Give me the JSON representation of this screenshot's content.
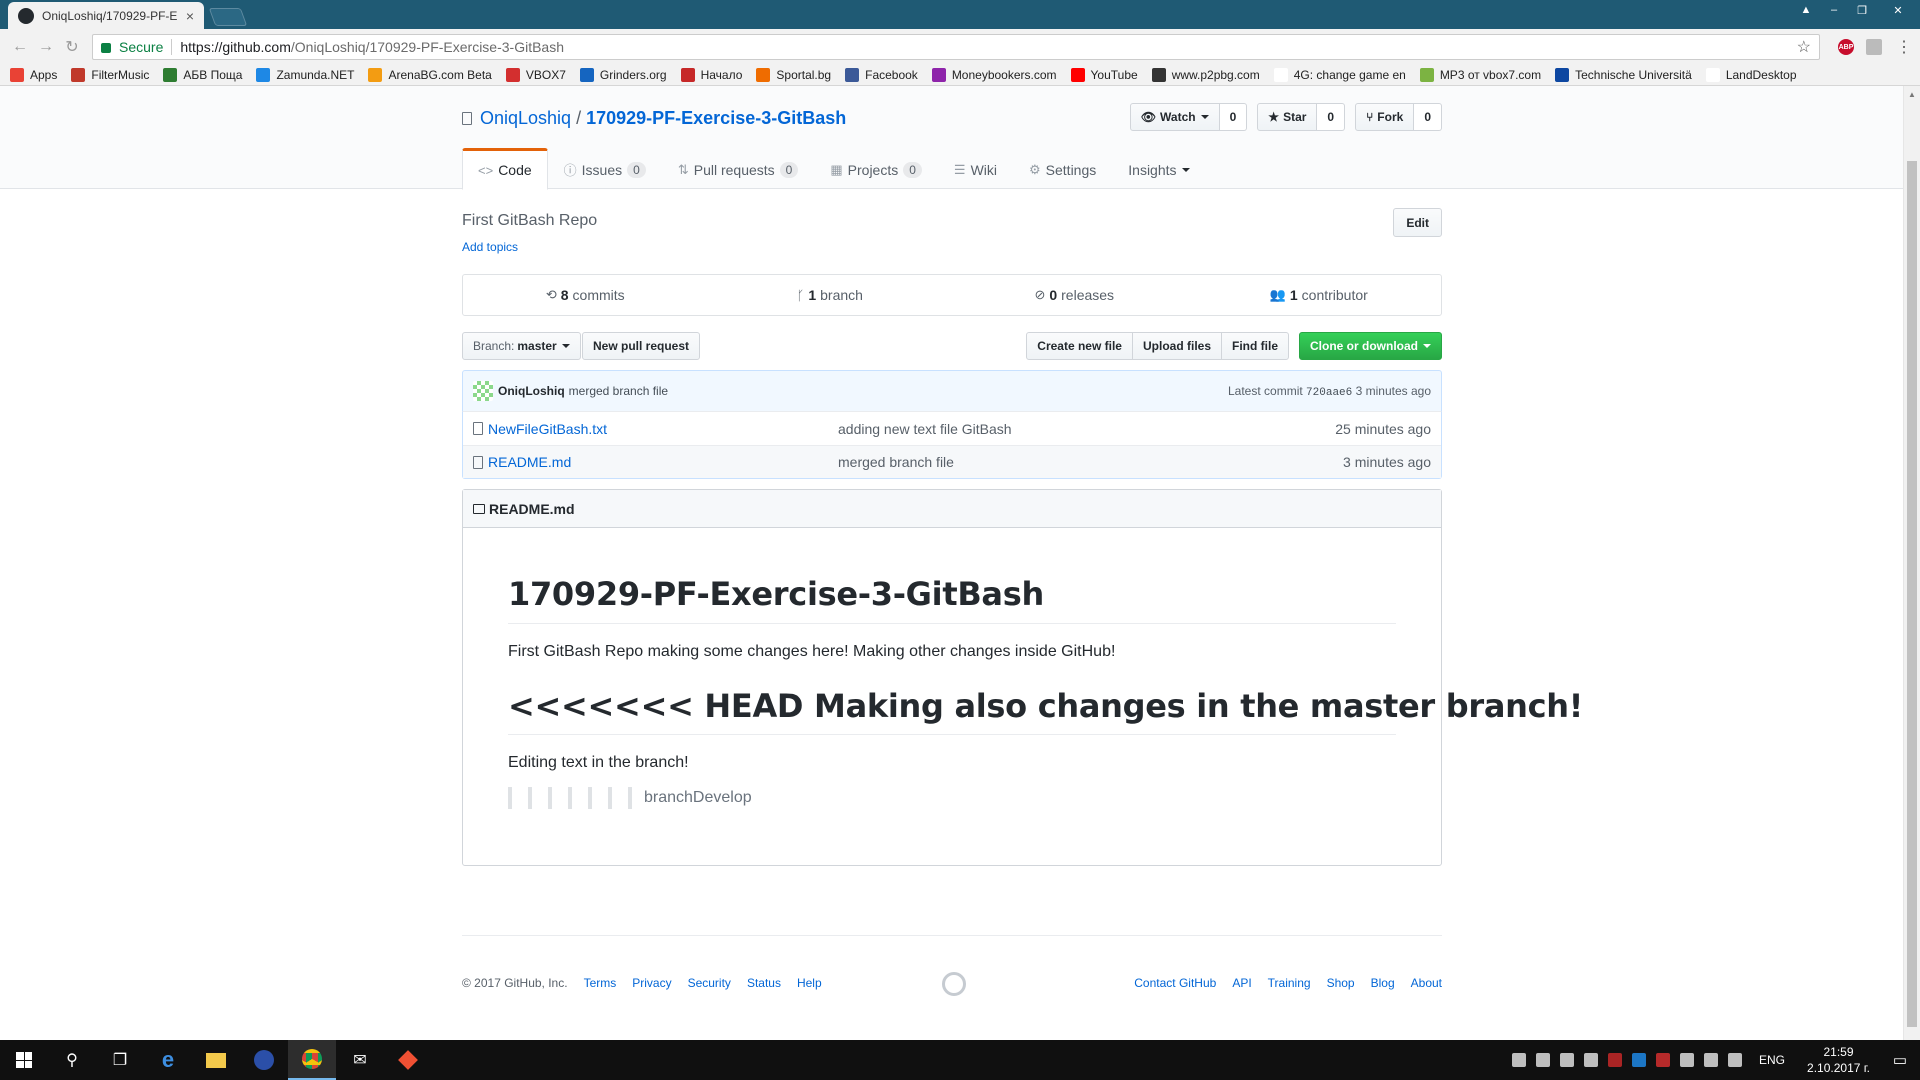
{
  "browser": {
    "tab_title": "OniqLoshiq/170929-PF-E",
    "tab_close": "×",
    "secure_label": "Secure",
    "url_host": "https://github.com",
    "url_path": "/OniqLoshiq/170929-PF-Exercise-3-GitBash",
    "abp_label": "ABP",
    "window_controls": [
      "▲",
      "–",
      "❐",
      "✕"
    ]
  },
  "bookmarks": [
    {
      "label": "Apps",
      "color": "#e94235"
    },
    {
      "label": "FilterMusic",
      "color": "#c0392b"
    },
    {
      "label": "АБВ Поща",
      "color": "#2e7d32"
    },
    {
      "label": "Zamunda.NET",
      "color": "#1e88e5"
    },
    {
      "label": "ArenaBG.com Beta",
      "color": "#f39c12"
    },
    {
      "label": "VBOX7",
      "color": "#d32f2f"
    },
    {
      "label": "Grinders.org",
      "color": "#1565c0"
    },
    {
      "label": "Начало",
      "color": "#c62828"
    },
    {
      "label": "Sportal.bg",
      "color": "#ef6c00"
    },
    {
      "label": "Facebook",
      "color": "#3b5998"
    },
    {
      "label": "Moneybookers.com",
      "color": "#8e24aa"
    },
    {
      "label": "YouTube",
      "color": "#ff0000"
    },
    {
      "label": "www.p2pbg.com",
      "color": "#333333"
    },
    {
      "label": "4G: change game en",
      "color": "#ffffff"
    },
    {
      "label": "MP3 от vbox7.com",
      "color": "#7cb342"
    },
    {
      "label": "Technische Universitä",
      "color": "#0d47a1"
    },
    {
      "label": "LandDesktop",
      "color": "#ffffff"
    }
  ],
  "repo": {
    "owner": "OniqLoshiq",
    "separator": "/",
    "name": "170929-PF-Exercise-3-GitBash",
    "actions": [
      {
        "icon": "👁",
        "label": "Watch",
        "count": "0",
        "dropdown": true
      },
      {
        "icon": "★",
        "label": "Star",
        "count": "0",
        "dropdown": false
      },
      {
        "icon": "⑂",
        "label": "Fork",
        "count": "0",
        "dropdown": false
      }
    ],
    "tabs": [
      {
        "icon": "<>",
        "label": "Code",
        "count": null
      },
      {
        "icon": "ⓘ",
        "label": "Issues",
        "count": "0"
      },
      {
        "icon": "⇅",
        "label": "Pull requests",
        "count": "0"
      },
      {
        "icon": "▦",
        "label": "Projects",
        "count": "0"
      },
      {
        "icon": "☰",
        "label": "Wiki",
        "count": null
      },
      {
        "icon": "⚙",
        "label": "Settings",
        "count": null
      },
      {
        "icon": "",
        "label": "Insights",
        "count": null
      }
    ],
    "description": "First GitBash Repo",
    "add_topics": "Add topics",
    "edit_label": "Edit",
    "summary": [
      {
        "icon": "⟲",
        "num": "8",
        "label": "commits"
      },
      {
        "icon": "ᚴ",
        "num": "1",
        "label": "branch"
      },
      {
        "icon": "⊘",
        "num": "0",
        "label": "releases"
      },
      {
        "icon": "👥",
        "num": "1",
        "label": "contributor"
      }
    ],
    "branch_label": "Branch:",
    "branch_value": "master",
    "new_pr": "New pull request",
    "file_buttons": [
      "Create new file",
      "Upload files",
      "Find file"
    ],
    "clone_label": "Clone or download",
    "commit": {
      "author": "OniqLoshiq",
      "message": "merged branch file",
      "latest_label": "Latest commit",
      "sha": "720aae6",
      "age": "3 minutes ago"
    },
    "files": [
      {
        "name": "NewFileGitBash.txt",
        "message": "adding new text file GitBash",
        "age": "25 minutes ago"
      },
      {
        "name": "README.md",
        "message": "merged branch file",
        "age": "3 minutes ago"
      }
    ],
    "readme": {
      "title": "README.md",
      "h1": "170929-PF-Exercise-3-GitBash",
      "p1": "First GitBash Repo making some changes here! Making other changes inside GitHub!",
      "h1b": "<<<<<<< HEAD Making also changes in the master branch!",
      "p2": "Editing text in the branch!",
      "quote": "branchDevelop"
    }
  },
  "footer": {
    "copyright": "© 2017 GitHub, Inc.",
    "left_links": [
      "Terms",
      "Privacy",
      "Security",
      "Status",
      "Help"
    ],
    "right_links": [
      "Contact GitHub",
      "API",
      "Training",
      "Shop",
      "Blog",
      "About"
    ]
  },
  "taskbar": {
    "lang": "ENG",
    "time": "21:59",
    "date": "2.10.2017 г."
  }
}
